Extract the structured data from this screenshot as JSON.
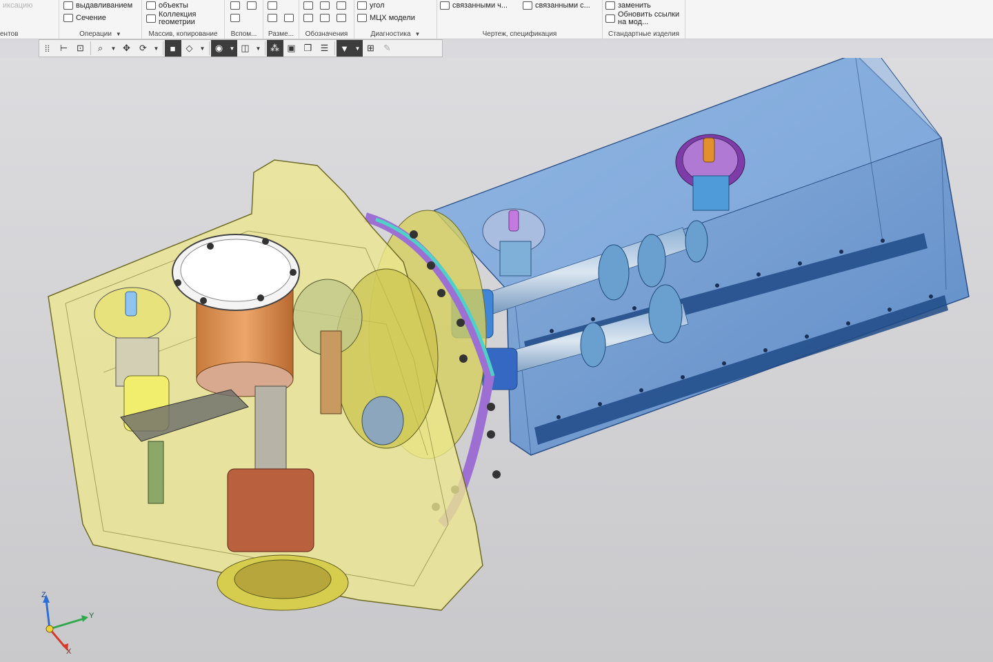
{
  "ribbon": {
    "groups": [
      {
        "title": "ентов",
        "items": []
      },
      {
        "title": "Операции",
        "items": [
          "выдавливанием",
          "Сечение"
        ]
      },
      {
        "title": "Массив, копирование",
        "items": [
          "объекты",
          "Коллекция геометрии"
        ]
      },
      {
        "title": "Вспом...",
        "items": []
      },
      {
        "title": "Разме...",
        "items": []
      },
      {
        "title": "Обозначения",
        "items": []
      },
      {
        "title": "Диагностика",
        "items": [
          "угол",
          "МЦХ модели"
        ]
      },
      {
        "title": "Чертеж, спецификация",
        "items": [
          "связанными ч...",
          "связанными с..."
        ]
      },
      {
        "title": "Стандартные изделия",
        "items": [
          "заменить",
          "Обновить ссылки на мод..."
        ]
      }
    ],
    "faded_top_left": "иксацию"
  },
  "toolbar": {
    "icons": [
      "grip-icon",
      "axis-cs-icon",
      "local-cs-icon",
      "zoom-icon",
      "zoom-dropdown",
      "pan-icon",
      "orbit-icon",
      "orbit-dropdown",
      "shaded-icon",
      "wireframe-icon",
      "display-dropdown",
      "hide-icon",
      "hide-dropdown",
      "section-view-icon",
      "section-dropdown",
      "select-filter-icon",
      "show-all-icon",
      "layers-icon",
      "properties-icon",
      "filter-icon",
      "filter-dropdown",
      "sheet-icon",
      "eyedropper-icon"
    ]
  },
  "axis": {
    "z": "Z",
    "y": "Y",
    "x": "X"
  },
  "colors": {
    "housing": "#e8e59a",
    "tank": "#5f93d1",
    "flange": "#b889e0",
    "cylinder": "#e0985a",
    "bolt": "#333333"
  }
}
